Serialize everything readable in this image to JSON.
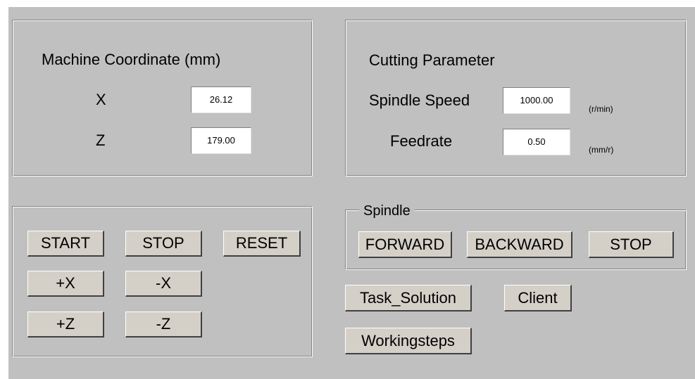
{
  "machine_coordinate": {
    "title": "Machine Coordinate  (mm)",
    "x_label": "X",
    "x_value": "26.12",
    "z_label": "Z",
    "z_value": "179.00"
  },
  "cutting_parameter": {
    "title": "Cutting Parameter",
    "spindle_speed_label": "Spindle Speed",
    "spindle_speed_value": "1000.00",
    "spindle_speed_unit": "(r/min)",
    "feedrate_label": "Feedrate",
    "feedrate_value": "0.50",
    "feedrate_unit": "(mm/r)"
  },
  "control": {
    "start": "START",
    "stop": "STOP",
    "reset": "RESET",
    "plus_x": "+X",
    "minus_x": "-X",
    "plus_z": "+Z",
    "minus_z": "-Z"
  },
  "spindle": {
    "title": "Spindle",
    "forward": "FORWARD",
    "backward": "BACKWARD",
    "stop": "STOP"
  },
  "actions": {
    "task_solution": "Task_Solution",
    "client": "Client",
    "workingsteps": "Workingsteps"
  }
}
